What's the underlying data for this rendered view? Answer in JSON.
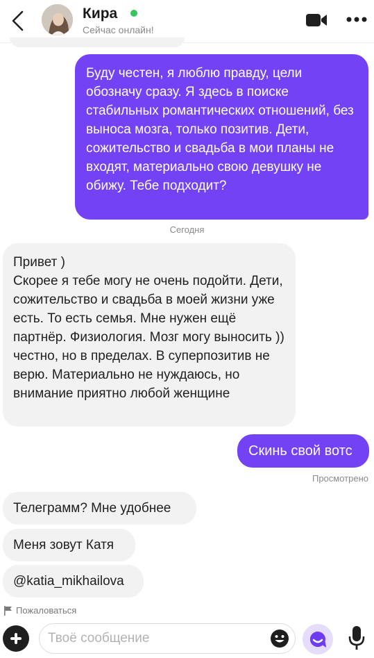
{
  "header": {
    "contact_name": "Кира",
    "status": "Сейчас онлайн!",
    "icons": [
      "back-arrow-icon",
      "video-call-icon",
      "more-icon"
    ],
    "online_color": "#35c759"
  },
  "messages": [
    {
      "side": "out",
      "text": "Буду честен, я люблю правду, цели обозначу сразу. Я здесь в поиске стабильных романтических отношений, без выноса мозга, только позитив. Дети, сожительство и свадьба в мои планы не входят, материально свою девушку не обижу. Тебе подходит?"
    },
    {
      "side": "in",
      "text": "Привет )\nСкорее я тебе могу не очень подойти. Дети, сожительство и свадьба в моей жизни уже есть. То есть семья. Мне нужен ещё партнёр. Физиология. Мозг могу выносить )) честно, но в пределах. В суперпозитив не верю. Материально не нуждаюсь, но внимание приятно любой женщине"
    },
    {
      "side": "out",
      "text": "Скинь свой вотс"
    },
    {
      "side": "in",
      "text": "Телеграмм? Мне удобнее"
    },
    {
      "side": "in",
      "text": "Меня зовут Катя"
    },
    {
      "side": "in",
      "text": "@katia_mikhailova"
    }
  ],
  "date_separator": "Сегодня",
  "read_status": "Просмотрено",
  "report_label": "Пожаловаться",
  "composer": {
    "placeholder": "Твоё сообщение",
    "icons": [
      "plus-icon",
      "emoji-icon",
      "ai-assistant-icon",
      "microphone-icon"
    ]
  },
  "colors": {
    "outgoing_bubble": "#7342f5",
    "incoming_bubble": "#f2f2f2",
    "accent": "#7342f5"
  }
}
